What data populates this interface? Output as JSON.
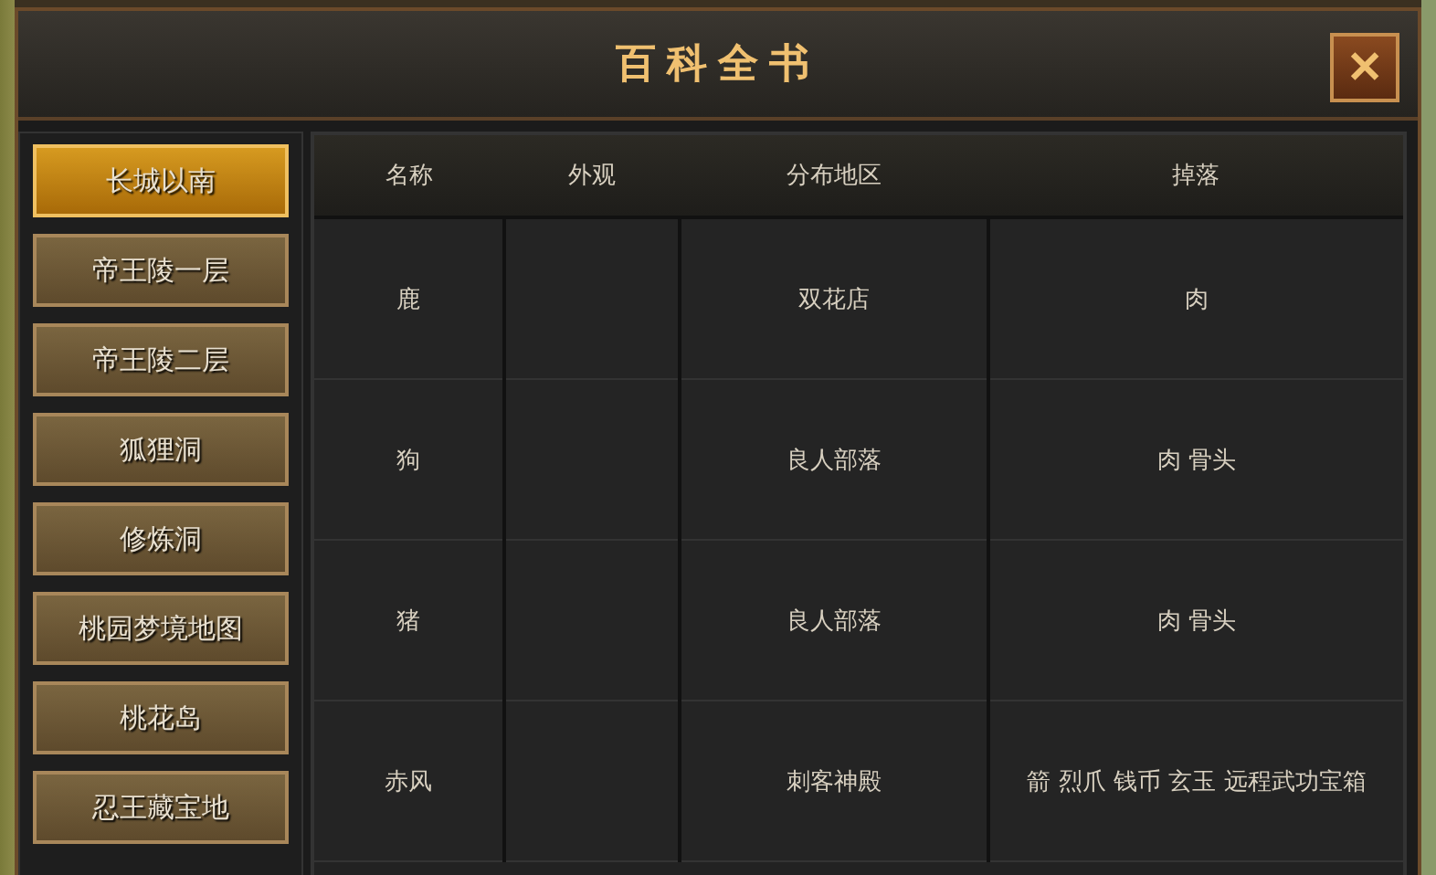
{
  "window": {
    "title": "百科全书",
    "close_label": "✕"
  },
  "sidebar": {
    "items": [
      {
        "label": "长城以南",
        "selected": true
      },
      {
        "label": "帝王陵一层",
        "selected": false
      },
      {
        "label": "帝王陵二层",
        "selected": false
      },
      {
        "label": "狐狸洞",
        "selected": false
      },
      {
        "label": "修炼洞",
        "selected": false
      },
      {
        "label": "桃园梦境地图",
        "selected": false
      },
      {
        "label": "桃花岛",
        "selected": false
      },
      {
        "label": "忍王藏宝地",
        "selected": false
      }
    ]
  },
  "table": {
    "columns": [
      "名称",
      "外观",
      "分布地区",
      "掉落"
    ],
    "rows": [
      {
        "name": "鹿",
        "region": "双花店",
        "drops": "肉"
      },
      {
        "name": "狗",
        "region": "良人部落",
        "drops": "肉 骨头"
      },
      {
        "name": "猪",
        "region": "良人部落",
        "drops": "肉 骨头"
      },
      {
        "name": "赤风",
        "region": "刺客神殿",
        "drops": "箭 烈爪 钱币 玄玉 远程武功宝箱"
      }
    ]
  }
}
